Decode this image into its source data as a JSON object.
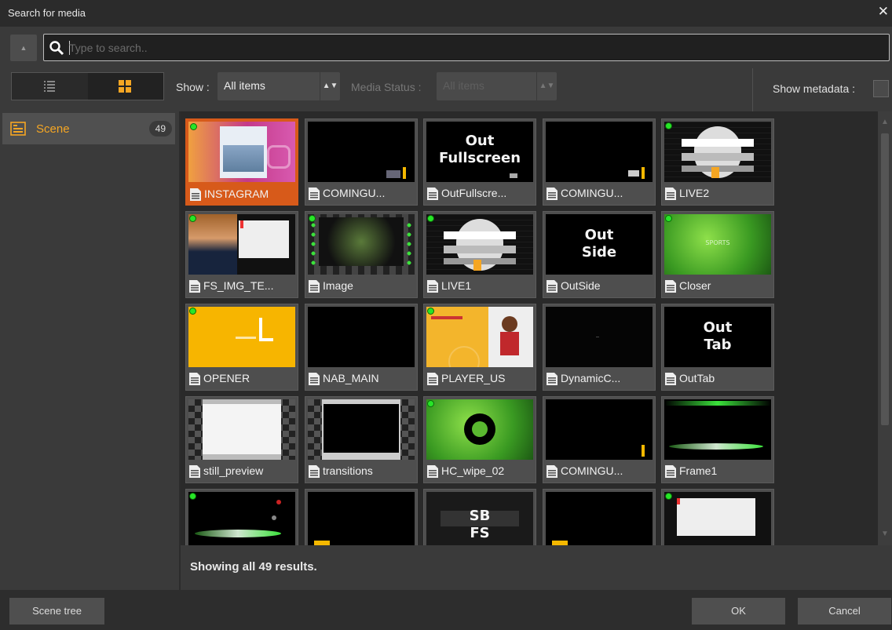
{
  "window": {
    "title": "Search for media",
    "close_label": "✕"
  },
  "search": {
    "placeholder": "Type to search.."
  },
  "toolbar": {
    "show_label": "Show :",
    "show_value": "All items",
    "media_status_label": "Media Status :",
    "media_status_value": "All items",
    "show_metadata_label": "Show metadata :"
  },
  "sidebar": {
    "items": [
      {
        "label": "Scene",
        "count": "49"
      }
    ]
  },
  "results": {
    "tiles": [
      {
        "caption": "INSTAGRAM",
        "selected": true
      },
      {
        "caption": "COMINGU..."
      },
      {
        "caption": "OutFullscre...",
        "thumb_text": [
          "Out",
          "Fullscreen"
        ]
      },
      {
        "caption": "COMINGU..."
      },
      {
        "caption": "LIVE2"
      },
      {
        "caption": "FS_IMG_TE..."
      },
      {
        "caption": "Image"
      },
      {
        "caption": "LIVE1"
      },
      {
        "caption": "OutSide",
        "thumb_text": [
          "Out",
          "Side"
        ]
      },
      {
        "caption": "Closer",
        "thumb_text": [
          "SPORTS"
        ]
      },
      {
        "caption": "OPENER"
      },
      {
        "caption": "NAB_MAIN"
      },
      {
        "caption": "PLAYER_US"
      },
      {
        "caption": "DynamicC..."
      },
      {
        "caption": "OutTab",
        "thumb_text": [
          "Out",
          "Tab"
        ]
      },
      {
        "caption": "still_preview"
      },
      {
        "caption": "transitions"
      },
      {
        "caption": "HC_wipe_02"
      },
      {
        "caption": "COMINGU..."
      },
      {
        "caption": "Frame1"
      },
      {
        "caption": ""
      },
      {
        "caption": ""
      },
      {
        "caption": "",
        "thumb_text": [
          "SB",
          "FS"
        ]
      },
      {
        "caption": ""
      },
      {
        "caption": ""
      }
    ]
  },
  "status": {
    "text": "Showing all 49 results."
  },
  "footer": {
    "scene_tree_label": "Scene tree",
    "ok_label": "OK",
    "cancel_label": "Cancel"
  },
  "colors": {
    "accent": "#f5a623",
    "selection": "#d75a1a",
    "status_dot": "#27e627"
  },
  "icons": [
    "close-icon",
    "search-icon",
    "list-view-icon",
    "grid-view-icon",
    "scene-folder-icon",
    "scene-file-icon",
    "stepper-icon"
  ]
}
